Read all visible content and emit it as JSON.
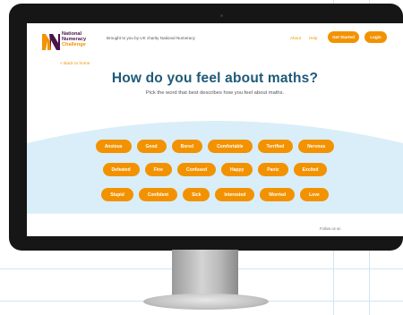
{
  "header": {
    "logo_text_line1": "National",
    "logo_text_line2": "Numeracy",
    "logo_text_line3": "Challenge",
    "tagline": "Brought to you by UK charity National Numeracy",
    "nav": {
      "about": "About",
      "help": "Help"
    },
    "get_started_label": "Get Started",
    "login_label": "Login"
  },
  "main": {
    "back_link": "< Back to home",
    "title": "How do you feel about maths?",
    "subtitle": "Pick the word that best describes how you feel about maths.",
    "word_rows": [
      [
        "Anxious",
        "Good",
        "Bored",
        "Comfortable",
        "Terrified",
        "Nervous"
      ],
      [
        "Defeated",
        "Fine",
        "Confused",
        "Happy",
        "Panic",
        "Excited"
      ],
      [
        "Stupid",
        "Confident",
        "Sick",
        "Interested",
        "Worried",
        "Love"
      ]
    ]
  },
  "footer": {
    "follow_text": "Follow us on"
  },
  "colors": {
    "accent": "#f39200",
    "title": "#1e5a78",
    "panel": "#d9eef8",
    "logo_purple": "#4a1448"
  }
}
